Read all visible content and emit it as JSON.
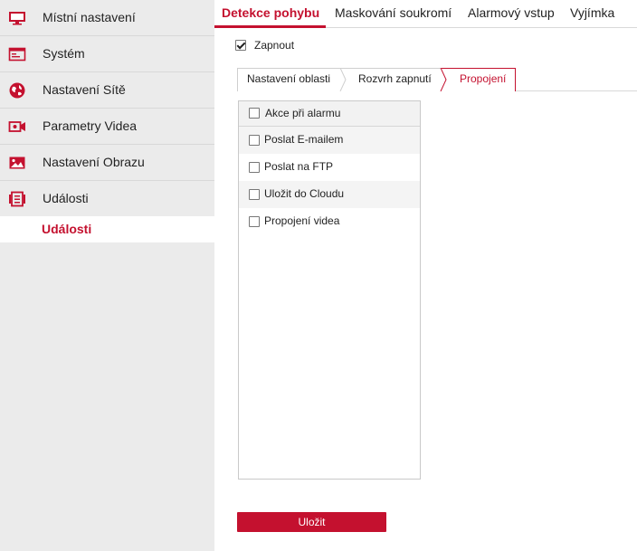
{
  "sidebar": {
    "items": [
      {
        "label": "Místní nastavení",
        "icon": "monitor-icon"
      },
      {
        "label": "Systém",
        "icon": "system-window-icon"
      },
      {
        "label": "Nastavení Sítě",
        "icon": "globe-icon"
      },
      {
        "label": "Parametry Videa",
        "icon": "video-camera-icon"
      },
      {
        "label": "Nastavení Obrazu",
        "icon": "image-icon"
      },
      {
        "label": "Události",
        "icon": "events-icon"
      }
    ],
    "sub_item": "Události"
  },
  "tabs": [
    {
      "label": "Detekce pohybu",
      "active": true
    },
    {
      "label": "Maskování soukromí",
      "active": false
    },
    {
      "label": "Alarmový vstup",
      "active": false
    },
    {
      "label": "Vyjímka",
      "active": false
    }
  ],
  "enable": {
    "label": "Zapnout",
    "checked": true
  },
  "subtabs": [
    {
      "label": "Nastavení oblasti",
      "active": false
    },
    {
      "label": "Rozvrh zapnutí",
      "active": false
    },
    {
      "label": "Propojení",
      "active": true
    }
  ],
  "actions": {
    "header": "Akce při alarmu",
    "items": [
      {
        "label": "Poslat E-mailem",
        "checked": false
      },
      {
        "label": "Poslat na FTP",
        "checked": false
      },
      {
        "label": "Uložit do Cloudu",
        "checked": false
      },
      {
        "label": "Propojení videa",
        "checked": false
      }
    ]
  },
  "save_label": "Uložit",
  "colors": {
    "accent": "#c4112f",
    "sidebar_bg": "#ebebeb"
  }
}
